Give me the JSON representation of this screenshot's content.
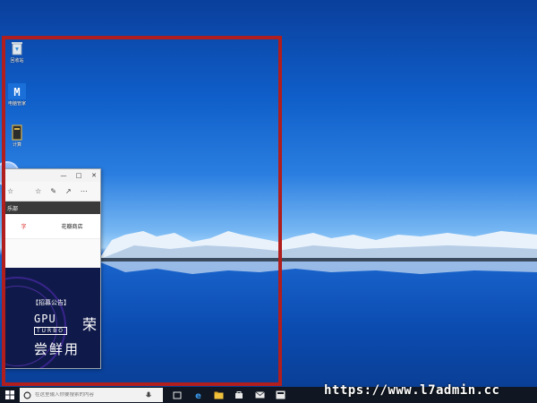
{
  "desktop": {
    "icons": [
      {
        "label": "回收站",
        "icon": "recycle-bin-icon"
      },
      {
        "label": "电脑管家",
        "icon": "pc-manager-icon"
      },
      {
        "label": "计算",
        "icon": "file-icon"
      }
    ]
  },
  "browser": {
    "controls": [
      "—",
      "□",
      "✕"
    ],
    "nav_label": "乐部",
    "menu": [
      {
        "label": "字",
        "active": true
      },
      {
        "label": "花瓣商店",
        "active": false
      }
    ],
    "banner": {
      "notice": "【招募公告】",
      "gpu": "GPU",
      "turbo": "TURBO",
      "rong": "荣",
      "taste": "尝鲜用"
    }
  },
  "taskbar": {
    "search_placeholder": "在这里输入你要搜索的内容"
  },
  "watermark": "https://www.l7admin.cc"
}
